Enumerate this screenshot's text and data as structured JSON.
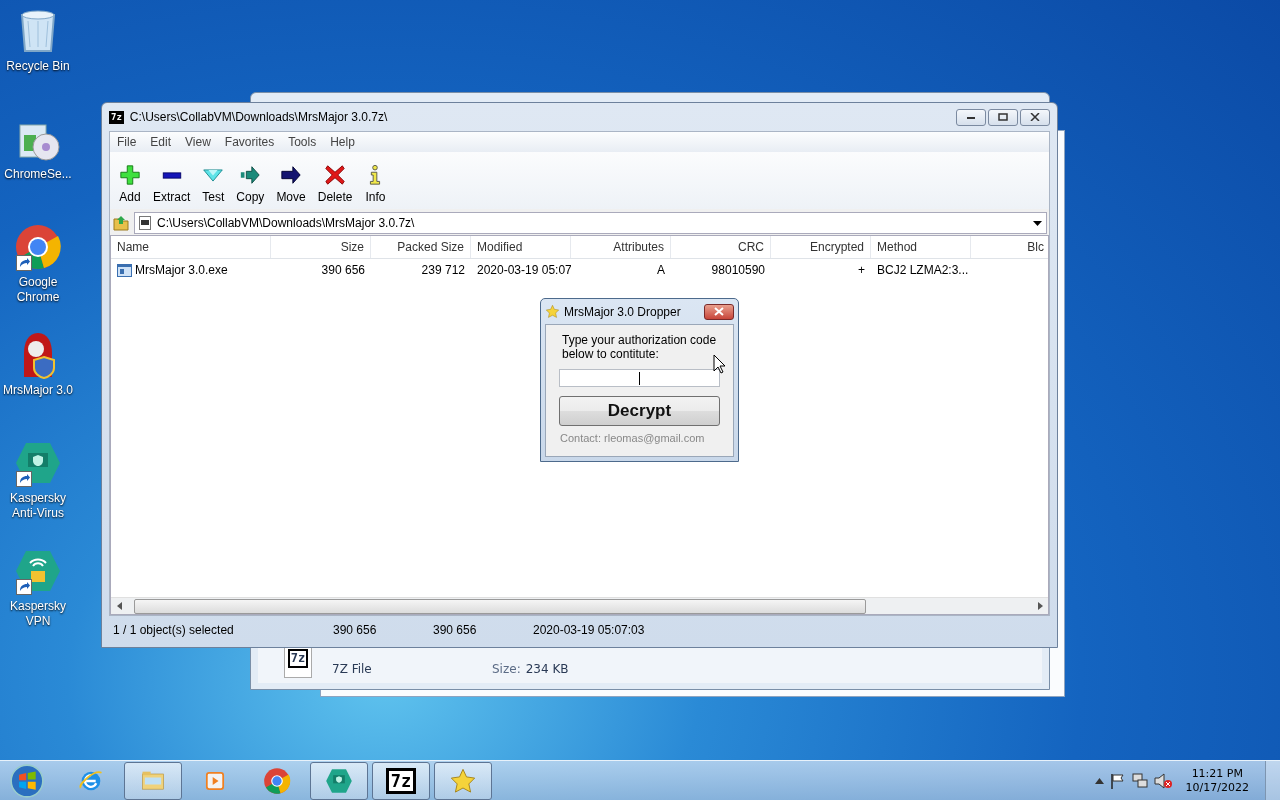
{
  "desktop_icons": [
    {
      "label": "Recycle Bin",
      "kind": "recycle",
      "shortcut": false
    },
    {
      "label": "ChromeSe...",
      "kind": "installer",
      "shortcut": false
    },
    {
      "label": "Google Chrome",
      "kind": "chrome",
      "shortcut": true
    },
    {
      "label": "MrsMajor 3.0",
      "kind": "doll",
      "shortcut": false
    },
    {
      "label": "Kaspersky Anti-Virus",
      "kind": "kav",
      "shortcut": true
    },
    {
      "label": "Kaspersky VPN",
      "kind": "vpn",
      "shortcut": true
    }
  ],
  "back_window": {
    "icon_text": "7z",
    "file_type": "7Z File",
    "size_label": "Size:",
    "size": "234 KB"
  },
  "window": {
    "icon_text": "7z",
    "title": "C:\\Users\\CollabVM\\Downloads\\MrsMajor 3.0.7z\\",
    "menu": [
      "File",
      "Edit",
      "View",
      "Favorites",
      "Tools",
      "Help"
    ],
    "toolbar": [
      {
        "label": "Add",
        "kind": "add"
      },
      {
        "label": "Extract",
        "kind": "extract"
      },
      {
        "label": "Test",
        "kind": "test"
      },
      {
        "label": "Copy",
        "kind": "copy"
      },
      {
        "label": "Move",
        "kind": "move"
      },
      {
        "label": "Delete",
        "kind": "delete"
      },
      {
        "label": "Info",
        "kind": "info"
      }
    ],
    "address": "C:\\Users\\CollabVM\\Downloads\\MrsMajor 3.0.7z\\",
    "columns": [
      "Name",
      "Size",
      "Packed Size",
      "Modified",
      "Attributes",
      "CRC",
      "Encrypted",
      "Method",
      "Blc"
    ],
    "rows": [
      {
        "cells": [
          "MrsMajor 3.0.exe",
          "390 656",
          "239 712",
          "2020-03-19 05:07",
          "A",
          "98010590",
          "+",
          "BCJ2 LZMA2:3...",
          ""
        ]
      }
    ],
    "status": [
      "1 / 1 object(s) selected",
      "390 656",
      "390 656",
      "2020-03-19 05:07:03"
    ]
  },
  "dialog": {
    "title": "MrsMajor 3.0 Dropper",
    "message": "Type your authorization code below to contitute:",
    "focused": true,
    "button": "Decrypt",
    "contact": "Contact: rleomas@gmail.com"
  },
  "taskbar": {
    "items": [
      {
        "kind": "ie",
        "open": false
      },
      {
        "kind": "explorer",
        "open": true
      },
      {
        "kind": "media",
        "open": false
      },
      {
        "kind": "chrome",
        "open": false
      },
      {
        "kind": "kav",
        "open": true
      },
      {
        "kind": "zip",
        "open": true,
        "text": "7z"
      },
      {
        "kind": "star",
        "open": true
      }
    ],
    "time": "11:21 PM",
    "date": "10/17/2022"
  }
}
